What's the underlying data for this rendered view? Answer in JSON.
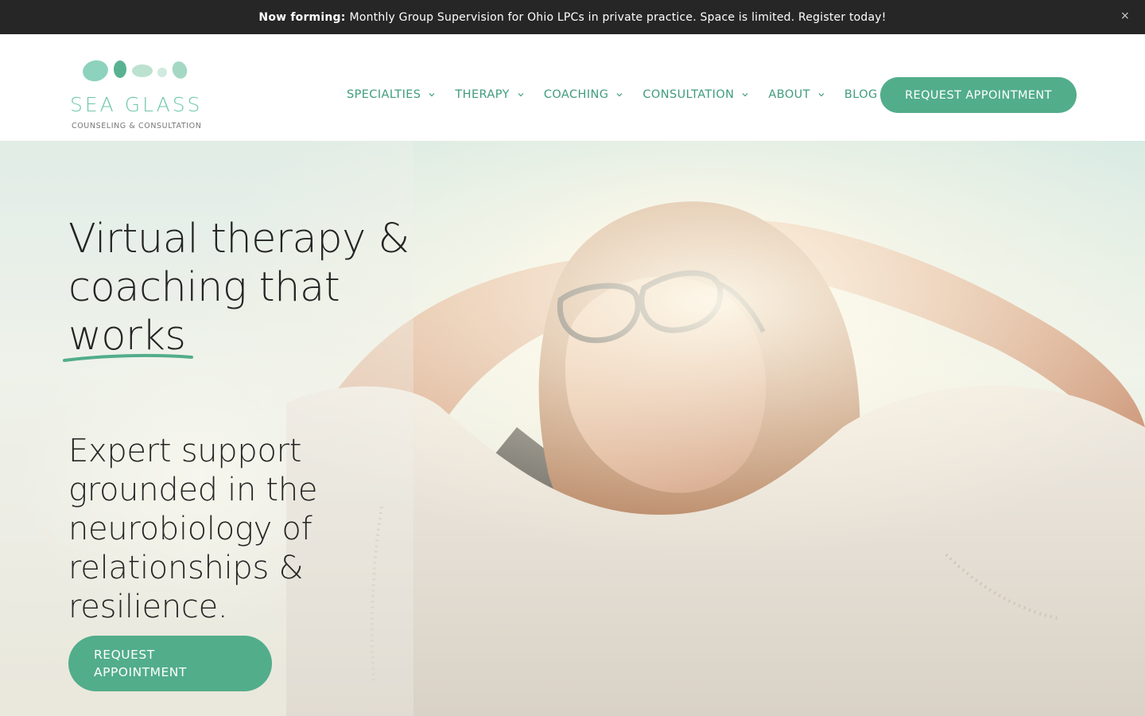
{
  "announcement": {
    "bold": "Now forming:",
    "text": "Monthly Group Supervision for Ohio LPCs in private practice. Space is limited. Register today!",
    "close": "×"
  },
  "logo": {
    "name": "SEA GLASS",
    "tagline": "COUNSELING & CONSULTATION",
    "colors": [
      "#7fcdb6",
      "#4fae8b",
      "#b8e0cc",
      "#cfe9dd",
      "#9ad4bf"
    ]
  },
  "nav": {
    "items": [
      {
        "label": "SPECIALTIES",
        "icon": "chevron-down-icon"
      },
      {
        "label": "THERAPY",
        "icon": "chevron-down-icon"
      },
      {
        "label": "COACHING",
        "icon": "chevron-down-icon"
      },
      {
        "label": "CONSULTATION",
        "icon": "chevron-down-icon"
      },
      {
        "label": "ABOUT",
        "icon": "chevron-down-icon"
      },
      {
        "label": "BLOG"
      }
    ],
    "cta": "REQUEST APPOINTMENT"
  },
  "hero": {
    "headline_line1": "Virtual therapy &",
    "headline_line2": "coaching that",
    "headline_accent": "works",
    "subhead": "Expert support grounded in the neurobiology of relationships & resilience.",
    "cta_line1": "REQUEST",
    "cta_line2": "APPOINTMENT"
  },
  "colors": {
    "accent": "#52ad8b",
    "nav_text": "#3f9c7d",
    "announcement_bg": "#262626"
  }
}
